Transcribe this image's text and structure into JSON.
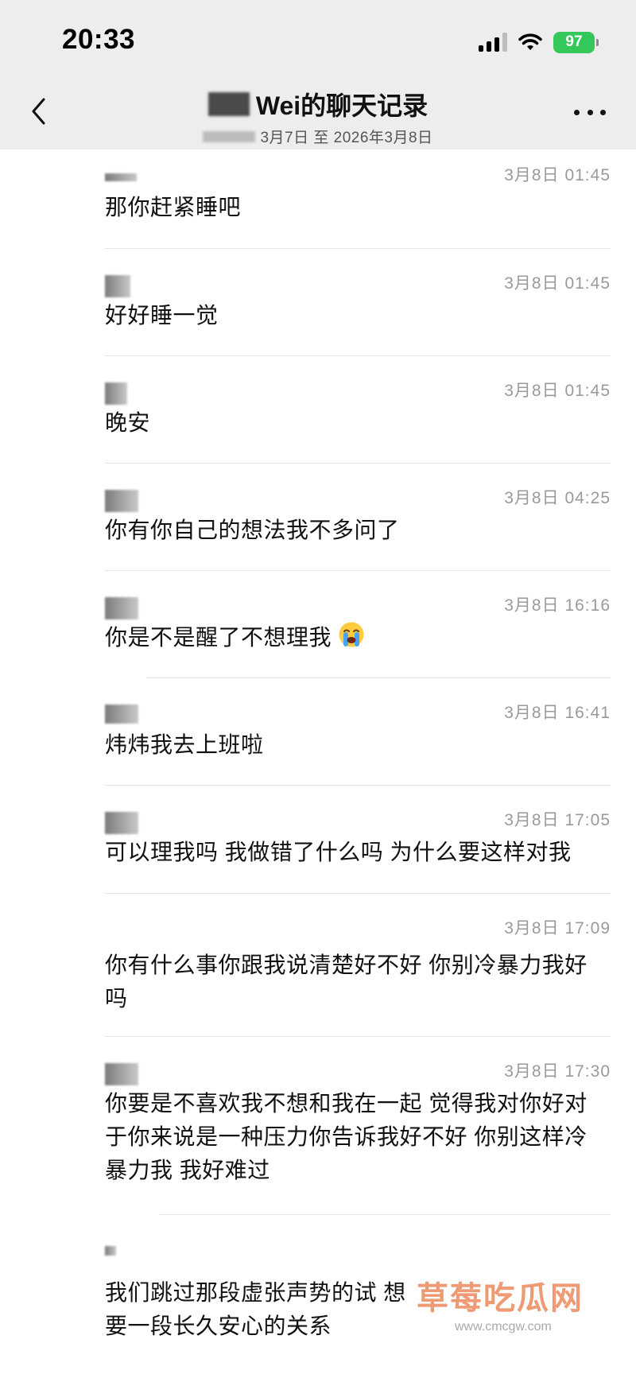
{
  "status_bar": {
    "time": "20:33",
    "battery": "97"
  },
  "header": {
    "title": "Wei的聊天记录",
    "subtitle": "3月7日 至 2026年3月8日"
  },
  "messages": [
    {
      "time": "3月8日 01:45",
      "text": "那你赶紧睡吧"
    },
    {
      "time": "3月8日 01:45",
      "text": "好好睡一觉"
    },
    {
      "time": "3月8日 01:45",
      "text": "晚安"
    },
    {
      "time": "3月8日 04:25",
      "text": "你有你自己的想法我不多问了"
    },
    {
      "time": "3月8日 16:16",
      "text": "你是不是醒了不想理我"
    },
    {
      "time": "3月8日 16:41",
      "text": "炜炜我去上班啦"
    },
    {
      "time": "3月8日 17:05",
      "text": "可以理我吗 我做错了什么吗 为什么要这样对我"
    },
    {
      "time": "3月8日 17:09",
      "text": "你有什么事你跟我说清楚好不好 你别冷暴力我好吗"
    },
    {
      "time": "3月8日 17:30",
      "text": "你要是不喜欢我不想和我在一起 觉得我对你好对于你来说是一种压力你告诉我好不好 你别这样冷暴力我 我好难过"
    },
    {
      "time": "",
      "text": "我们跳过那段虚张声势的试 想要一段长久安心的关系"
    }
  ],
  "watermark": {
    "name": "草莓吃瓜网",
    "url": "www.cmcgw.com"
  }
}
